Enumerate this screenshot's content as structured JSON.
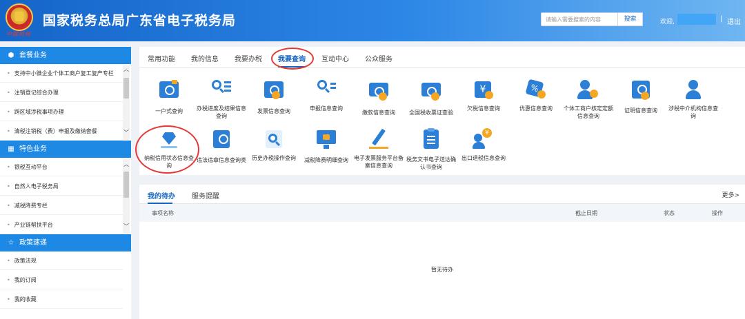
{
  "header": {
    "title": "国家税务总局广东省电子税务局",
    "logo_text": "中國稅務",
    "search_placeholder": "请输入需要搜索的内容",
    "search_button": "搜索",
    "welcome": "欢迎,",
    "separator": "|",
    "logout": "退出"
  },
  "sidebar": {
    "sections": [
      {
        "title": "套餐业务",
        "icon": "cube-icon",
        "items": [
          "支持中小微企业个体工商户复工复产专栏",
          "注销登记综合办理",
          "跨区域涉税事项办理",
          "清税注销税（费）申报及缴纳套餐"
        ]
      },
      {
        "title": "特色业务",
        "icon": "grid-icon",
        "items": [
          "银税互动平台",
          "自然人电子税务局",
          "减税降费专栏",
          "产业链帮扶平台"
        ]
      },
      {
        "title": "政策速递",
        "icon": "star-icon",
        "items": [
          "政策法规",
          "我的订阅",
          "我的收藏"
        ]
      }
    ]
  },
  "tabs": [
    "常用功能",
    "我的信息",
    "我要办税",
    "我要查询",
    "互动中心",
    "公众服务"
  ],
  "active_tab": "我要查询",
  "query_items": [
    {
      "label": "一户式查询",
      "icon": "card-search-icon"
    },
    {
      "label": "办税进度及结果信息查询",
      "icon": "list-search-icon"
    },
    {
      "label": "发票信息查询",
      "icon": "invoice-search-icon"
    },
    {
      "label": "申报信息查询",
      "icon": "declaration-search-icon"
    },
    {
      "label": "缴款信息查询",
      "icon": "payment-search-icon"
    },
    {
      "label": "全国税收票证查验",
      "icon": "tax-certificate-icon"
    },
    {
      "label": "欠税信息查询",
      "icon": "arrears-search-icon"
    },
    {
      "label": "优惠信息查询",
      "icon": "discount-search-icon"
    },
    {
      "label": "个体工商户核定定额信息查询",
      "icon": "individual-business-icon"
    },
    {
      "label": "证明信息查询",
      "icon": "certificate-search-icon"
    },
    {
      "label": "涉税中介机构信息查询",
      "icon": "agency-person-icon"
    },
    {
      "label": "纳税信用状态信息查询",
      "icon": "credit-diamond-icon"
    },
    {
      "label": "违法违章信息查询类",
      "icon": "violation-doc-icon"
    },
    {
      "label": "历史办税操作查询",
      "icon": "history-search-icon"
    },
    {
      "label": "减税降费明细查询",
      "icon": "tax-reduction-monitor-icon"
    },
    {
      "label": "电子发票服务平台备案信息查询",
      "icon": "e-invoice-pen-icon"
    },
    {
      "label": "税务文书电子送达确认书查询",
      "icon": "document-clipboard-icon"
    },
    {
      "label": "出口退税信息查询",
      "icon": "export-refund-icon"
    }
  ],
  "todo": {
    "tabs": [
      "我的待办",
      "服务提醒"
    ],
    "more": "更多>",
    "columns": [
      "事项名称",
      "截止日期",
      "状态",
      "操作"
    ],
    "empty": "暂无待办"
  }
}
